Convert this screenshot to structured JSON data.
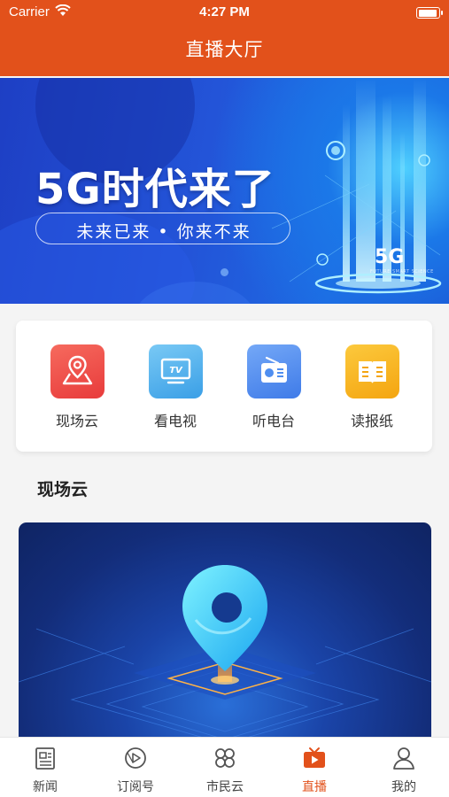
{
  "status": {
    "carrier": "Carrier",
    "time": "4:27 PM"
  },
  "header": {
    "title": "直播大厅"
  },
  "banner": {
    "headline": "5G时代来了",
    "slogan": "未来已来 • 你来不来",
    "badge": "5G",
    "badge_sub": "FUTURE SMART SCIENCE"
  },
  "entries": [
    {
      "label": "现场云",
      "icon": "location-map-icon",
      "color": "#ef4b4b"
    },
    {
      "label": "看电视",
      "icon": "tv-icon",
      "color": "#4fb1ee",
      "icon_text": "TV"
    },
    {
      "label": "听电台",
      "icon": "radio-icon",
      "color": "#4f8ef0"
    },
    {
      "label": "读报纸",
      "icon": "newspaper-icon",
      "color": "#f7b21a"
    }
  ],
  "section": {
    "title": "现场云"
  },
  "tabs": [
    {
      "label": "新闻",
      "icon": "news-icon"
    },
    {
      "label": "订阅号",
      "icon": "subscribe-icon"
    },
    {
      "label": "市民云",
      "icon": "grid-icon"
    },
    {
      "label": "直播",
      "icon": "live-tv-icon",
      "active": true
    },
    {
      "label": "我的",
      "icon": "profile-icon"
    }
  ],
  "colors": {
    "accent": "#e2511b",
    "header_bg": "#e2511b",
    "page_bg": "#f4f4f4"
  }
}
